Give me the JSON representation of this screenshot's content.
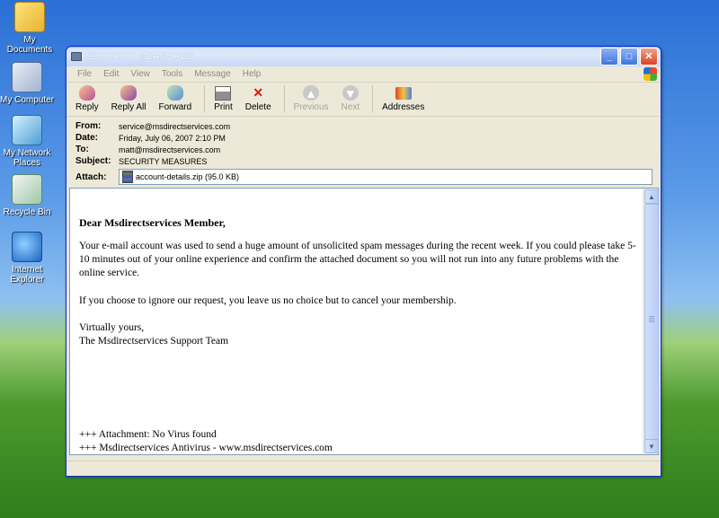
{
  "desktop": {
    "icons": [
      {
        "label": "My Documents"
      },
      {
        "label": "My Computer"
      },
      {
        "label": "My Network Places"
      },
      {
        "label": "Recycle Bin"
      },
      {
        "label": "Internet Explorer"
      }
    ]
  },
  "window": {
    "title": "SECURITY MEASURES",
    "menu": [
      "File",
      "Edit",
      "View",
      "Tools",
      "Message",
      "Help"
    ],
    "toolbar": {
      "reply": "Reply",
      "reply_all": "Reply All",
      "forward": "Forward",
      "print": "Print",
      "delete": "Delete",
      "previous": "Previous",
      "next": "Next",
      "addresses": "Addresses"
    }
  },
  "header": {
    "from_label": "From:",
    "from": "service@msdirectservices.com",
    "date_label": "Date:",
    "date": "Friday, July 06, 2007 2:10 PM",
    "to_label": "To:",
    "to": "matt@msdirectservices.com",
    "subject_label": "Subject:",
    "subject": "SECURITY MEASURES",
    "attach_label": "Attach:",
    "attachment": "account-details.zip (95.0 KB)"
  },
  "message": {
    "greeting": "Dear Msdirectservices Member,",
    "paragraph1": "Your e-mail account was used to send a huge amount of unsolicited spam messages during the recent week. If you could please take 5-10 minutes out of your online experience and confirm the attached document so you will not run into any future problems with the online service.",
    "paragraph2": "If you choose to ignore our request, you leave us no choice but to cancel your membership.",
    "signoff": "Virtually yours,",
    "signature": "The Msdirectservices Support Team",
    "footer1": "+++ Attachment: No Virus found",
    "footer2": "+++ Msdirectservices Antivirus - www.msdirectservices.com"
  }
}
